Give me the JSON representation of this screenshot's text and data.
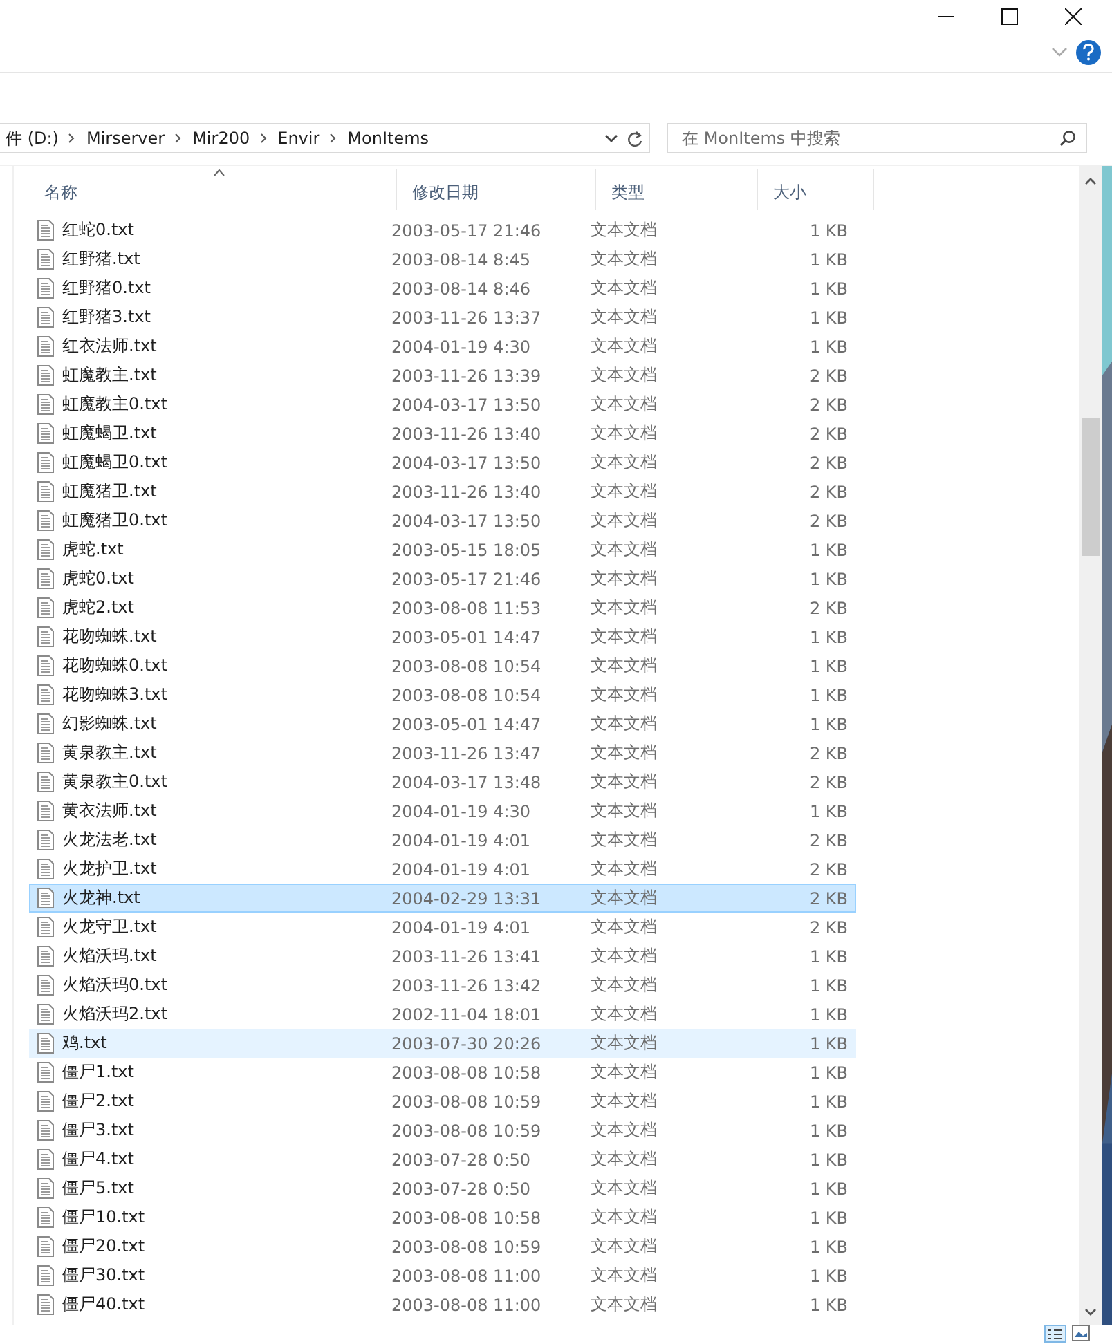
{
  "breadcrumbs": [
    "件 (D:)",
    "Mirserver",
    "Mir200",
    "Envir",
    "MonItems"
  ],
  "search": {
    "placeholder": "在 MonItems 中搜索"
  },
  "columns": [
    {
      "label": "名称",
      "sorted": true
    },
    {
      "label": "修改日期",
      "sorted": false
    },
    {
      "label": "类型",
      "sorted": false
    },
    {
      "label": "大小",
      "sorted": false
    }
  ],
  "rows": [
    {
      "name": "红蛇0.txt",
      "date": "2003-05-17 21:46",
      "type": "文本文档",
      "size": "1 KB",
      "selected": false,
      "hovered": false
    },
    {
      "name": "红野猪.txt",
      "date": "2003-08-14 8:45",
      "type": "文本文档",
      "size": "1 KB",
      "selected": false,
      "hovered": false
    },
    {
      "name": "红野猪0.txt",
      "date": "2003-08-14 8:46",
      "type": "文本文档",
      "size": "1 KB",
      "selected": false,
      "hovered": false
    },
    {
      "name": "红野猪3.txt",
      "date": "2003-11-26 13:37",
      "type": "文本文档",
      "size": "1 KB",
      "selected": false,
      "hovered": false
    },
    {
      "name": "红衣法师.txt",
      "date": "2004-01-19 4:30",
      "type": "文本文档",
      "size": "1 KB",
      "selected": false,
      "hovered": false
    },
    {
      "name": "虹魔教主.txt",
      "date": "2003-11-26 13:39",
      "type": "文本文档",
      "size": "2 KB",
      "selected": false,
      "hovered": false
    },
    {
      "name": "虹魔教主0.txt",
      "date": "2004-03-17 13:50",
      "type": "文本文档",
      "size": "2 KB",
      "selected": false,
      "hovered": false
    },
    {
      "name": "虹魔蝎卫.txt",
      "date": "2003-11-26 13:40",
      "type": "文本文档",
      "size": "2 KB",
      "selected": false,
      "hovered": false
    },
    {
      "name": "虹魔蝎卫0.txt",
      "date": "2004-03-17 13:50",
      "type": "文本文档",
      "size": "2 KB",
      "selected": false,
      "hovered": false
    },
    {
      "name": "虹魔猪卫.txt",
      "date": "2003-11-26 13:40",
      "type": "文本文档",
      "size": "2 KB",
      "selected": false,
      "hovered": false
    },
    {
      "name": "虹魔猪卫0.txt",
      "date": "2004-03-17 13:50",
      "type": "文本文档",
      "size": "2 KB",
      "selected": false,
      "hovered": false
    },
    {
      "name": "虎蛇.txt",
      "date": "2003-05-15 18:05",
      "type": "文本文档",
      "size": "1 KB",
      "selected": false,
      "hovered": false
    },
    {
      "name": "虎蛇0.txt",
      "date": "2003-05-17 21:46",
      "type": "文本文档",
      "size": "1 KB",
      "selected": false,
      "hovered": false
    },
    {
      "name": "虎蛇2.txt",
      "date": "2003-08-08 11:53",
      "type": "文本文档",
      "size": "2 KB",
      "selected": false,
      "hovered": false
    },
    {
      "name": "花吻蜘蛛.txt",
      "date": "2003-05-01 14:47",
      "type": "文本文档",
      "size": "1 KB",
      "selected": false,
      "hovered": false
    },
    {
      "name": "花吻蜘蛛0.txt",
      "date": "2003-08-08 10:54",
      "type": "文本文档",
      "size": "1 KB",
      "selected": false,
      "hovered": false
    },
    {
      "name": "花吻蜘蛛3.txt",
      "date": "2003-08-08 10:54",
      "type": "文本文档",
      "size": "1 KB",
      "selected": false,
      "hovered": false
    },
    {
      "name": "幻影蜘蛛.txt",
      "date": "2003-05-01 14:47",
      "type": "文本文档",
      "size": "1 KB",
      "selected": false,
      "hovered": false
    },
    {
      "name": "黄泉教主.txt",
      "date": "2003-11-26 13:47",
      "type": "文本文档",
      "size": "2 KB",
      "selected": false,
      "hovered": false
    },
    {
      "name": "黄泉教主0.txt",
      "date": "2004-03-17 13:48",
      "type": "文本文档",
      "size": "2 KB",
      "selected": false,
      "hovered": false
    },
    {
      "name": "黄衣法师.txt",
      "date": "2004-01-19 4:30",
      "type": "文本文档",
      "size": "1 KB",
      "selected": false,
      "hovered": false
    },
    {
      "name": "火龙法老.txt",
      "date": "2004-01-19 4:01",
      "type": "文本文档",
      "size": "2 KB",
      "selected": false,
      "hovered": false
    },
    {
      "name": "火龙护卫.txt",
      "date": "2004-01-19 4:01",
      "type": "文本文档",
      "size": "2 KB",
      "selected": false,
      "hovered": false
    },
    {
      "name": "火龙神.txt",
      "date": "2004-02-29 13:31",
      "type": "文本文档",
      "size": "2 KB",
      "selected": true,
      "hovered": false
    },
    {
      "name": "火龙守卫.txt",
      "date": "2004-01-19 4:01",
      "type": "文本文档",
      "size": "2 KB",
      "selected": false,
      "hovered": false
    },
    {
      "name": "火焰沃玛.txt",
      "date": "2003-11-26 13:41",
      "type": "文本文档",
      "size": "1 KB",
      "selected": false,
      "hovered": false
    },
    {
      "name": "火焰沃玛0.txt",
      "date": "2003-11-26 13:42",
      "type": "文本文档",
      "size": "1 KB",
      "selected": false,
      "hovered": false
    },
    {
      "name": "火焰沃玛2.txt",
      "date": "2002-11-04 18:01",
      "type": "文本文档",
      "size": "1 KB",
      "selected": false,
      "hovered": false
    },
    {
      "name": "鸡.txt",
      "date": "2003-07-30 20:26",
      "type": "文本文档",
      "size": "1 KB",
      "selected": false,
      "hovered": true
    },
    {
      "name": "僵尸1.txt",
      "date": "2003-08-08 10:58",
      "type": "文本文档",
      "size": "1 KB",
      "selected": false,
      "hovered": false
    },
    {
      "name": "僵尸2.txt",
      "date": "2003-08-08 10:59",
      "type": "文本文档",
      "size": "1 KB",
      "selected": false,
      "hovered": false
    },
    {
      "name": "僵尸3.txt",
      "date": "2003-08-08 10:59",
      "type": "文本文档",
      "size": "1 KB",
      "selected": false,
      "hovered": false
    },
    {
      "name": "僵尸4.txt",
      "date": "2003-07-28 0:50",
      "type": "文本文档",
      "size": "1 KB",
      "selected": false,
      "hovered": false
    },
    {
      "name": "僵尸5.txt",
      "date": "2003-07-28 0:50",
      "type": "文本文档",
      "size": "1 KB",
      "selected": false,
      "hovered": false
    },
    {
      "name": "僵尸10.txt",
      "date": "2003-08-08 10:58",
      "type": "文本文档",
      "size": "1 KB",
      "selected": false,
      "hovered": false
    },
    {
      "name": "僵尸20.txt",
      "date": "2003-08-08 10:59",
      "type": "文本文档",
      "size": "1 KB",
      "selected": false,
      "hovered": false
    },
    {
      "name": "僵尸30.txt",
      "date": "2003-08-08 11:00",
      "type": "文本文档",
      "size": "1 KB",
      "selected": false,
      "hovered": false
    },
    {
      "name": "僵尸40.txt",
      "date": "2003-08-08 11:00",
      "type": "文本文档",
      "size": "1 KB",
      "selected": false,
      "hovered": false
    }
  ]
}
